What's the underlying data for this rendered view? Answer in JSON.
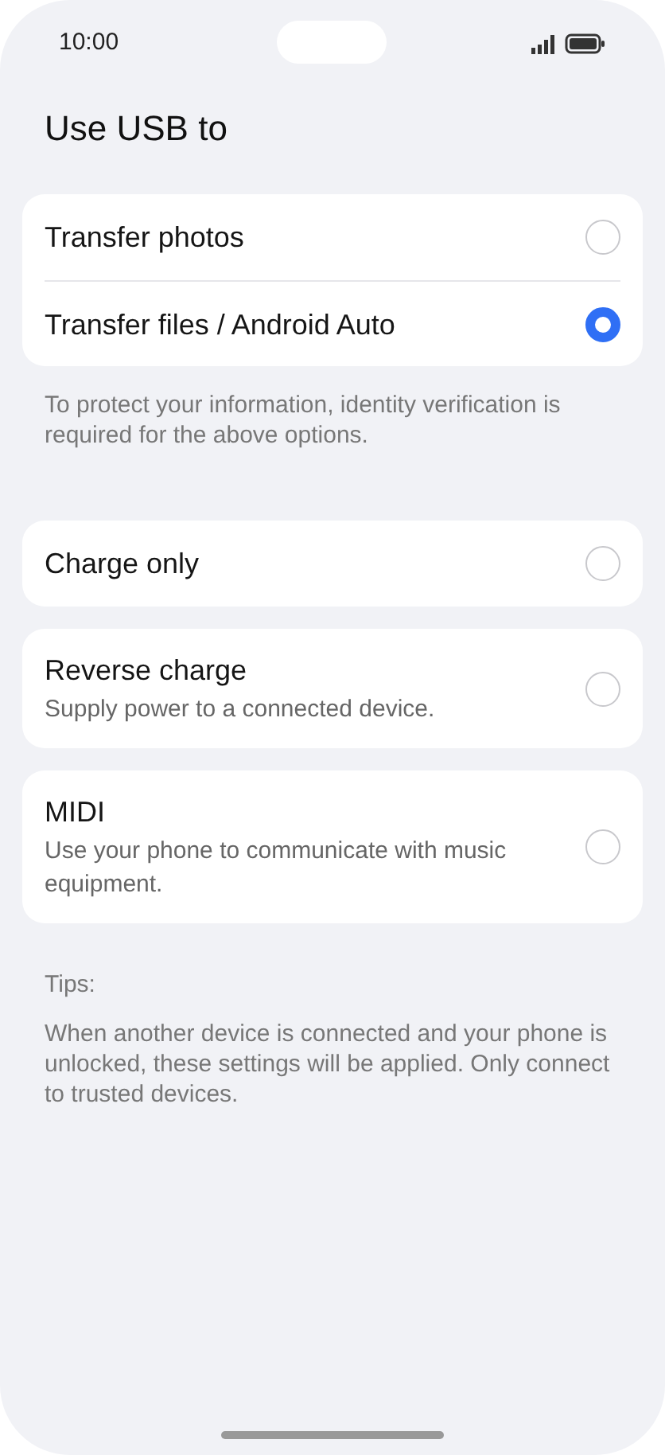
{
  "status_bar": {
    "time": "10:00"
  },
  "title": "Use USB to",
  "groups": [
    {
      "options": [
        {
          "title": "Transfer photos",
          "selected": false
        },
        {
          "title": "Transfer files / Android Auto",
          "selected": true
        }
      ],
      "note": "To protect your information, identity verification is required for the above options."
    },
    {
      "options": [
        {
          "title": "Charge only",
          "selected": false
        }
      ]
    },
    {
      "options": [
        {
          "title": "Reverse charge",
          "subtitle": "Supply power to a connected device.",
          "selected": false
        }
      ]
    },
    {
      "options": [
        {
          "title": "MIDI",
          "subtitle": "Use your phone to communicate with music equipment.",
          "selected": false
        }
      ]
    }
  ],
  "tips": {
    "heading": "Tips:",
    "text": "When another device is connected and your phone is unlocked, these settings will be applied. Only connect to trusted devices."
  }
}
